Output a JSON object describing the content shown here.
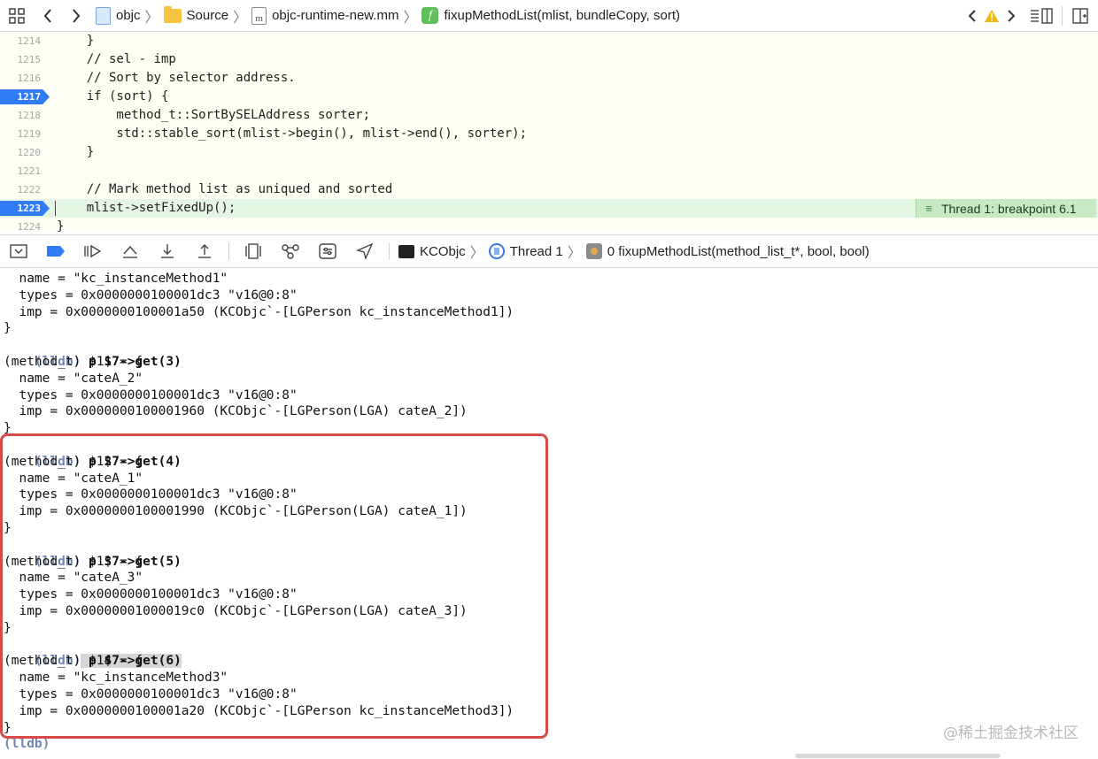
{
  "jumpbar": {
    "crumbs": [
      {
        "label": "objc",
        "icon": "xcode-project-icon"
      },
      {
        "label": "Source",
        "icon": "folder-icon"
      },
      {
        "label": "objc-runtime-new.mm",
        "icon": "objc-file-icon"
      },
      {
        "label": "fixupMethodList(mlist, bundleCopy, sort)",
        "icon": "function-icon"
      }
    ],
    "warning_color": "#f2b705"
  },
  "editor": {
    "lines": [
      {
        "num": "1214",
        "text": "    }"
      },
      {
        "num": "1215",
        "text": "    // sel - imp"
      },
      {
        "num": "1216",
        "text": "    // Sort by selector address."
      },
      {
        "num": "1217",
        "text": "    if (sort) {"
      },
      {
        "num": "1218",
        "text": "        method_t::SortBySELAddress sorter;"
      },
      {
        "num": "1219",
        "text": "        std::stable_sort(mlist->begin(), mlist->end(), sorter);"
      },
      {
        "num": "1220",
        "text": "    }"
      },
      {
        "num": "1221",
        "text": ""
      },
      {
        "num": "1222",
        "text": "    // Mark method list as uniqued and sorted"
      },
      {
        "num": "1223",
        "text": "    mlist->setFixedUp();"
      },
      {
        "num": "1224",
        "text": "}"
      }
    ],
    "breakpoint_label": "Thread 1: breakpoint 6.1",
    "accent": "#2f7cf6",
    "active_line_color": "#e4f5e4"
  },
  "debugbar": {
    "process": "KCObjc",
    "thread": "Thread 1",
    "frame": "0 fixupMethodList(method_list_t*, bool, bool)"
  },
  "console": {
    "lines": [
      "  name = \"kc_instanceMethod1\"",
      "  types = 0x0000000100001dc3 \"v16@0:8\"",
      "  imp = 0x0000000100001a50 (KCObjc`-[LGPerson kc_instanceMethod1])",
      "}",
      "(lldb) p $7->get(3)",
      "(method_t) $11 = {",
      "  name = \"cateA_2\"",
      "  types = 0x0000000100001dc3 \"v16@0:8\"",
      "  imp = 0x0000000100001960 (KCObjc`-[LGPerson(LGA) cateA_2])",
      "}",
      "(lldb) p $7->get(4)",
      "(method_t) $12 = {",
      "  name = \"cateA_1\"",
      "  types = 0x0000000100001dc3 \"v16@0:8\"",
      "  imp = 0x0000000100001990 (KCObjc`-[LGPerson(LGA) cateA_1])",
      "}",
      "(lldb) p $7->get(5)",
      "(method_t) $13 = {",
      "  name = \"cateA_3\"",
      "  types = 0x0000000100001dc3 \"v16@0:8\"",
      "  imp = 0x00000001000019c0 (KCObjc`-[LGPerson(LGA) cateA_3])",
      "}",
      "(lldb) p $7->get(6)",
      "(method_t) $14 = {",
      "  name = \"kc_instanceMethod3\"",
      "  types = 0x0000000100001dc3 \"v16@0:8\"",
      "  imp = 0x0000000100001a20 (KCObjc`-[LGPerson kc_instanceMethod3])",
      "}",
      "(lldb)"
    ],
    "prompt_color": "#6f86b2",
    "highlight_color": "#d84a4a",
    "watermark": "@稀土掘金技术社区"
  }
}
